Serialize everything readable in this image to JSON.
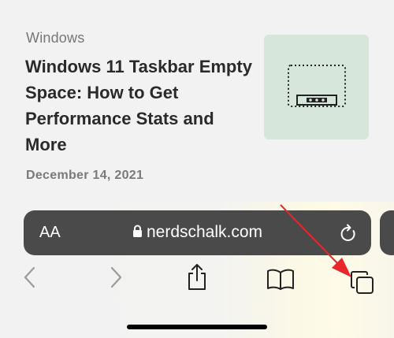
{
  "article": {
    "category": "Windows",
    "title": "Windows 11 Taskbar Empty Space: How to Get Performance Stats and More",
    "date": "December 14, 2021"
  },
  "address_bar": {
    "text_size_label": "AA",
    "url": "nerdschalk.com"
  },
  "icons": {
    "text_size": "aa-icon",
    "lock": "lock-icon",
    "reload": "reload-icon",
    "back": "chevron-left-icon",
    "forward": "chevron-right-icon",
    "share": "share-icon",
    "bookmarks": "book-icon",
    "tabs": "tabs-icon"
  },
  "colors": {
    "address_bar_bg": "#4a4a4a",
    "annotation_arrow": "#e8262b",
    "thumbnail_bg": "#d6e6da"
  }
}
